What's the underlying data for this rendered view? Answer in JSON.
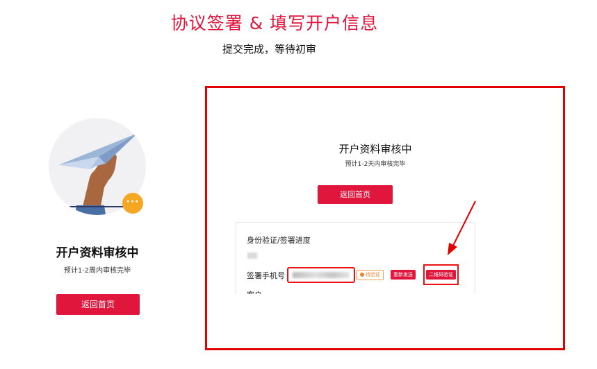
{
  "header": {
    "title": "协议签署 & 填写开户信息",
    "subtitle": "提交完成，等待初审"
  },
  "left_panel": {
    "illustration": "paper-plane-hand",
    "badge": "···",
    "title": "开户资料审核中",
    "subtitle": "预计1-2周内审核完毕",
    "button_label": "返回首页"
  },
  "right_panel": {
    "title": "开户资料审核中",
    "subtitle": "预计1-2天内审核完毕",
    "button_label": "返回首页",
    "card": {
      "title": "身份验证/签署进度",
      "phone_label": "签署手机号",
      "pending_tag": "待验证",
      "resend_label": "重新发送",
      "qr_label": "二维码验证",
      "next_row_label": "客户"
    }
  },
  "colors": {
    "accent": "#e1163c",
    "annotation": "#e10000",
    "pending": "#f0822e",
    "badge": "#f5a623"
  }
}
